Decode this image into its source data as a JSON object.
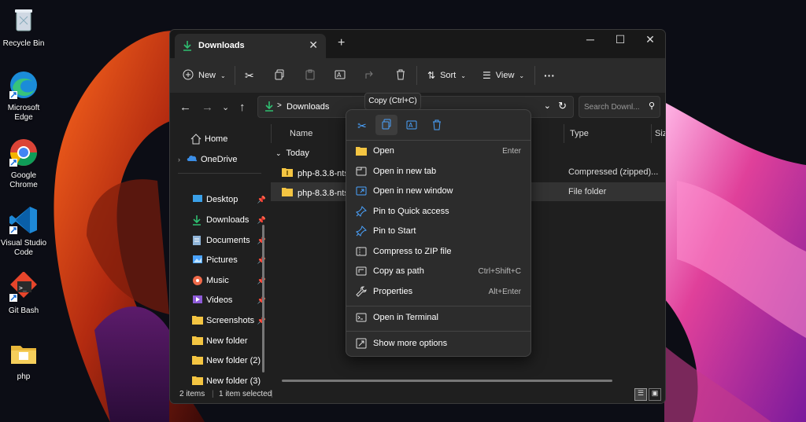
{
  "desktop": {
    "icons": [
      {
        "label": "Recycle Bin",
        "icon": "recycle-bin-icon"
      },
      {
        "label": "Microsoft Edge",
        "icon": "edge-icon"
      },
      {
        "label": "Google Chrome",
        "icon": "chrome-icon"
      },
      {
        "label": "Visual Studio Code",
        "icon": "vscode-icon"
      },
      {
        "label": "Git Bash",
        "icon": "git-bash-icon"
      },
      {
        "label": "php",
        "icon": "folder-icon"
      }
    ]
  },
  "window": {
    "tab_title": "Downloads",
    "toolbar": {
      "new_label": "New",
      "sort_label": "Sort",
      "view_label": "View",
      "more_label": "···"
    },
    "address": {
      "crumb": "Downloads",
      "separator": ">"
    },
    "search_placeholder": "Search Downl...",
    "nav": [
      {
        "label": "Home",
        "icon": "home-icon"
      },
      {
        "label": "OneDrive",
        "icon": "onedrive-icon"
      },
      {
        "label": "Desktop",
        "icon": "desktop-icon",
        "pinned": true
      },
      {
        "label": "Downloads",
        "icon": "download-icon",
        "pinned": true
      },
      {
        "label": "Documents",
        "icon": "documents-icon",
        "pinned": true
      },
      {
        "label": "Pictures",
        "icon": "pictures-icon",
        "pinned": true
      },
      {
        "label": "Music",
        "icon": "music-icon",
        "pinned": true
      },
      {
        "label": "Videos",
        "icon": "videos-icon",
        "pinned": true
      },
      {
        "label": "Screenshots",
        "icon": "folder-icon",
        "pinned": true
      },
      {
        "label": "New folder",
        "icon": "folder-icon"
      },
      {
        "label": "New folder (2)",
        "icon": "folder-icon"
      },
      {
        "label": "New folder (3)",
        "icon": "folder-icon"
      }
    ],
    "columns": {
      "name": "Name",
      "type": "Type",
      "size": "Size"
    },
    "group": "Today",
    "files": [
      {
        "name": "php-8.3.8-nts-W",
        "type": "Compressed (zipped)..."
      },
      {
        "name": "php-8.3.8-nts-W",
        "type": "File folder"
      }
    ],
    "status": {
      "count": "2 items",
      "selected": "1 item selected"
    }
  },
  "tooltip": "Copy (Ctrl+C)",
  "context_menu": {
    "items": [
      {
        "label": "Open",
        "shortcut": "Enter",
        "icon": "folder-open-icon"
      },
      {
        "label": "Open in new tab",
        "shortcut": "",
        "icon": "new-tab-icon"
      },
      {
        "label": "Open in new window",
        "shortcut": "",
        "icon": "new-window-icon"
      },
      {
        "label": "Pin to Quick access",
        "shortcut": "",
        "icon": "pin-icon"
      },
      {
        "label": "Pin to Start",
        "shortcut": "",
        "icon": "pin-icon"
      },
      {
        "label": "Compress to ZIP file",
        "shortcut": "",
        "icon": "zip-icon"
      },
      {
        "label": "Copy as path",
        "shortcut": "Ctrl+Shift+C",
        "icon": "copy-path-icon"
      },
      {
        "label": "Properties",
        "shortcut": "Alt+Enter",
        "icon": "wrench-icon"
      },
      {
        "label": "Open in Terminal",
        "shortcut": "",
        "icon": "terminal-icon"
      },
      {
        "label": "Show more options",
        "shortcut": "",
        "icon": "more-options-icon"
      }
    ]
  },
  "colors": {
    "window_bg": "#1f1f1f",
    "accent_green": "#2fbf71",
    "folder_yellow": "#f4c542",
    "accent_blue": "#4aa3ff"
  }
}
